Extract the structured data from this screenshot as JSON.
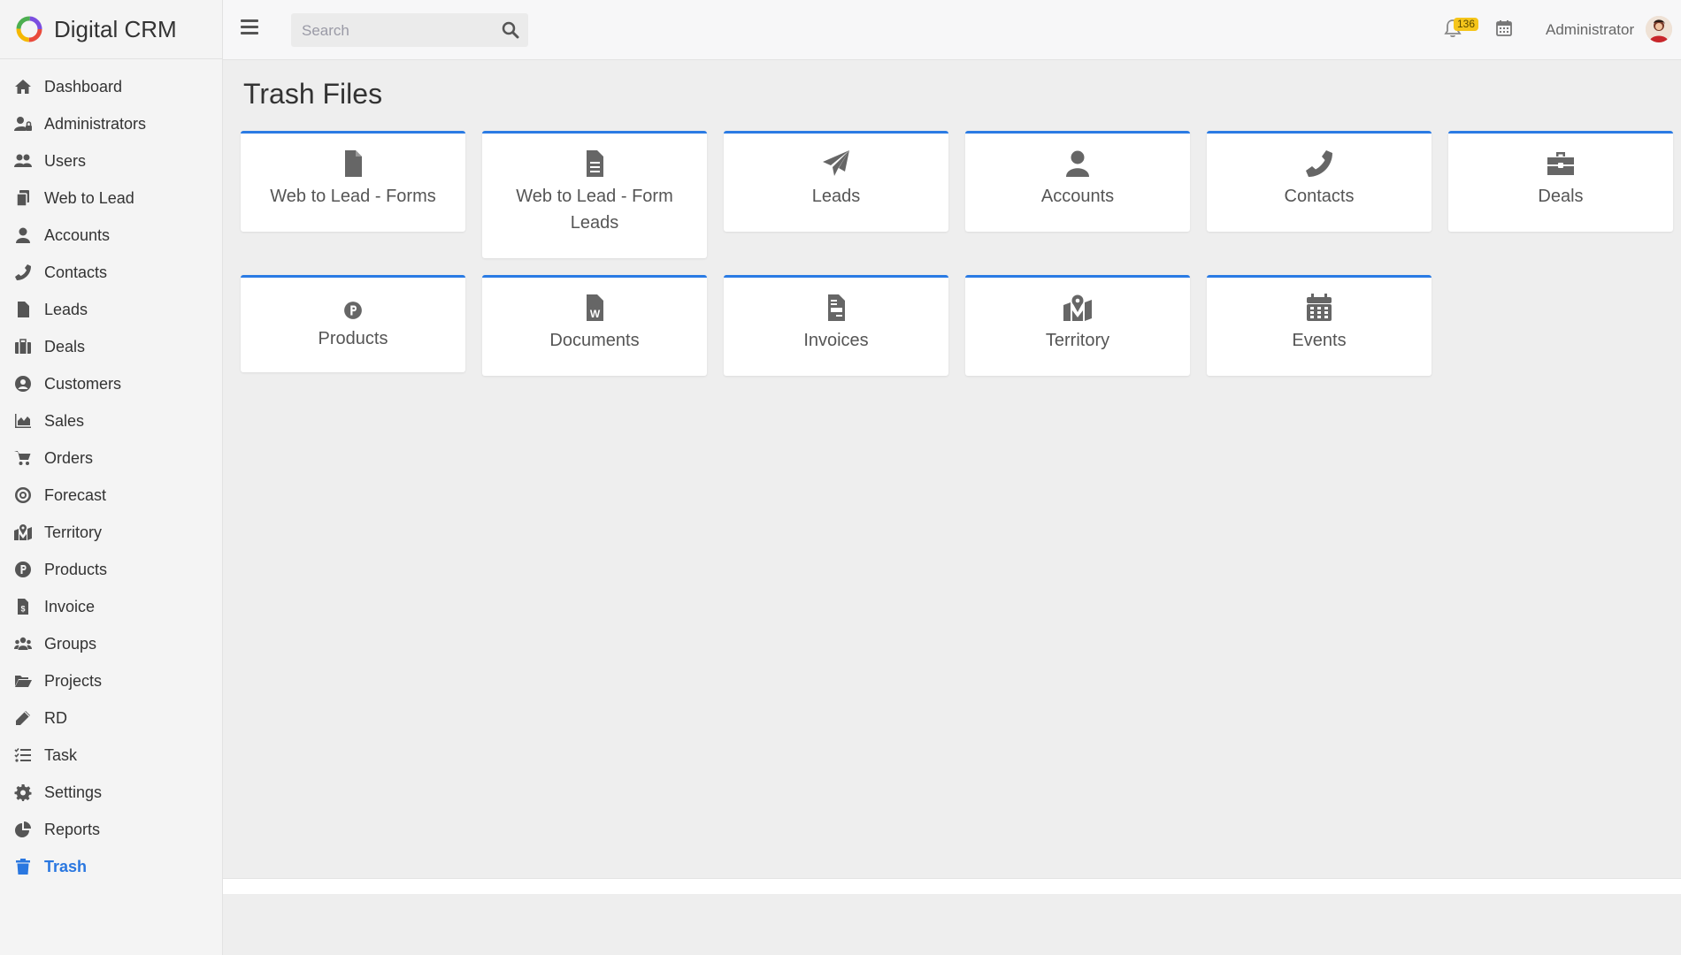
{
  "brand": {
    "name": "Digital CRM"
  },
  "topbar": {
    "search_placeholder": "Search",
    "notification_count": "136",
    "user_name": "Administrator"
  },
  "sidebar": {
    "items": [
      {
        "label": "Dashboard",
        "icon": "home-icon"
      },
      {
        "label": "Administrators",
        "icon": "user-lock-icon"
      },
      {
        "label": "Users",
        "icon": "users-icon"
      },
      {
        "label": "Web to Lead",
        "icon": "copy-icon"
      },
      {
        "label": "Accounts",
        "icon": "user-icon"
      },
      {
        "label": "Contacts",
        "icon": "phone-icon"
      },
      {
        "label": "Leads",
        "icon": "file-icon"
      },
      {
        "label": "Deals",
        "icon": "suitcase-icon"
      },
      {
        "label": "Customers",
        "icon": "user-circle-icon"
      },
      {
        "label": "Sales",
        "icon": "area-chart-icon"
      },
      {
        "label": "Orders",
        "icon": "cart-icon"
      },
      {
        "label": "Forecast",
        "icon": "bullseye-icon"
      },
      {
        "label": "Territory",
        "icon": "map-marker-icon"
      },
      {
        "label": "Products",
        "icon": "product-p-icon"
      },
      {
        "label": "Invoice",
        "icon": "invoice-icon"
      },
      {
        "label": "Groups",
        "icon": "group-icon"
      },
      {
        "label": "Projects",
        "icon": "folder-open-icon"
      },
      {
        "label": "RD",
        "icon": "pen-icon"
      },
      {
        "label": "Task",
        "icon": "task-list-icon"
      },
      {
        "label": "Settings",
        "icon": "gear-icon"
      },
      {
        "label": "Reports",
        "icon": "pie-chart-icon"
      },
      {
        "label": "Trash",
        "icon": "trash-icon",
        "active": true
      }
    ]
  },
  "main": {
    "title": "Trash Files",
    "cards": [
      {
        "label": "Web to Lead - Forms",
        "icon": "file-icon"
      },
      {
        "label": "Web to Lead - Form Leads",
        "icon": "file-lines-icon"
      },
      {
        "label": "Leads",
        "icon": "paper-plane-icon"
      },
      {
        "label": "Accounts",
        "icon": "user-icon"
      },
      {
        "label": "Contacts",
        "icon": "phone-icon"
      },
      {
        "label": "Deals",
        "icon": "briefcase-icon"
      },
      {
        "label": "Products",
        "icon": "product-p-icon"
      },
      {
        "label": "Documents",
        "icon": "word-file-icon"
      },
      {
        "label": "Invoices",
        "icon": "invoice-icon"
      },
      {
        "label": "Territory",
        "icon": "map-marker-icon"
      },
      {
        "label": "Events",
        "icon": "calendar-icon"
      }
    ]
  },
  "colors": {
    "accent": "#2a7be4",
    "active_nav": "#2a77e0",
    "badge": "#f5c51b"
  }
}
